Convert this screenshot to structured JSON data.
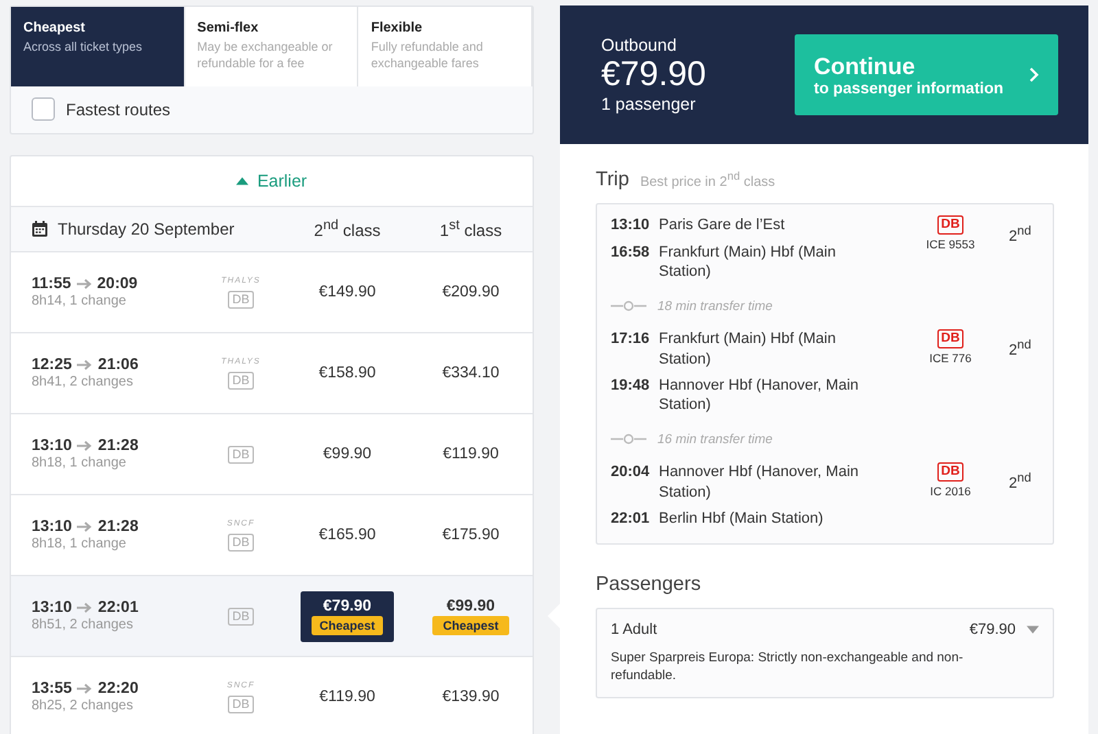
{
  "fare_tabs": [
    {
      "title": "Cheapest",
      "subtitle": "Across all ticket types",
      "selected": true
    },
    {
      "title": "Semi-flex",
      "subtitle": "May be exchangeable or refundable for a fee",
      "selected": false
    },
    {
      "title": "Flexible",
      "subtitle": "Fully refundable and exchangeable fares",
      "selected": false
    }
  ],
  "fastest_routes": {
    "label": "Fastest routes",
    "checked": false
  },
  "earlier_link": "Earlier",
  "results_header": {
    "date": "Thursday 20 September",
    "class_2": "2$^{nd}$ class",
    "class_1": "1$^{st}$ class"
  },
  "journeys": [
    {
      "depart": "11:55",
      "arrive": "20:09",
      "summary": "8h14, 1 change",
      "operators": [
        "THALYS",
        "DB"
      ],
      "selected": false,
      "prices": [
        {
          "price": "€149.90",
          "cheapest": false,
          "selected": false
        },
        {
          "price": "€209.90",
          "cheapest": false,
          "selected": false
        }
      ]
    },
    {
      "depart": "12:25",
      "arrive": "21:06",
      "summary": "8h41, 2 changes",
      "operators": [
        "THALYS",
        "DB"
      ],
      "selected": false,
      "prices": [
        {
          "price": "€158.90",
          "cheapest": false,
          "selected": false
        },
        {
          "price": "€334.10",
          "cheapest": false,
          "selected": false
        }
      ]
    },
    {
      "depart": "13:10",
      "arrive": "21:28",
      "summary": "8h18, 1 change",
      "operators": [
        "DB"
      ],
      "selected": false,
      "prices": [
        {
          "price": "€99.90",
          "cheapest": false,
          "selected": false
        },
        {
          "price": "€119.90",
          "cheapest": false,
          "selected": false
        }
      ]
    },
    {
      "depart": "13:10",
      "arrive": "21:28",
      "summary": "8h18, 1 change",
      "operators": [
        "SNCF",
        "DB"
      ],
      "selected": false,
      "prices": [
        {
          "price": "€165.90",
          "cheapest": false,
          "selected": false
        },
        {
          "price": "€175.90",
          "cheapest": false,
          "selected": false
        }
      ]
    },
    {
      "depart": "13:10",
      "arrive": "22:01",
      "summary": "8h51, 2 changes",
      "operators": [
        "DB"
      ],
      "selected": true,
      "prices": [
        {
          "price": "€79.90",
          "cheapest": true,
          "badge": "Cheapest",
          "selected": true
        },
        {
          "price": "€99.90",
          "cheapest": true,
          "badge": "Cheapest",
          "selected": false
        }
      ]
    },
    {
      "depart": "13:55",
      "arrive": "22:20",
      "summary": "8h25, 2 changes",
      "operators": [
        "SNCF",
        "DB"
      ],
      "selected": false,
      "prices": [
        {
          "price": "€119.90",
          "cheapest": false,
          "selected": false
        },
        {
          "price": "€139.90",
          "cheapest": false,
          "selected": false
        }
      ]
    }
  ],
  "summary": {
    "direction": "Outbound",
    "price": "€79.90",
    "passengers": "1 passenger",
    "continue_title": "Continue",
    "continue_subtitle": "to passenger information"
  },
  "trip": {
    "heading": "Trip",
    "note": "Best price in 2$^{nd}$ class",
    "segments": [
      {
        "kind": "leg",
        "dep_time": "13:10",
        "dep_station": "Paris Gare de l’Est",
        "arr_time": "16:58",
        "arr_station": "Frankfurt (Main) Hbf (Main Station)",
        "operator": "DB",
        "train": "ICE 9553",
        "class": "2$^{nd}$"
      },
      {
        "kind": "transfer",
        "text": "18 min transfer time"
      },
      {
        "kind": "leg",
        "dep_time": "17:16",
        "dep_station": "Frankfurt (Main) Hbf (Main Station)",
        "arr_time": "19:48",
        "arr_station": "Hannover Hbf (Hanover, Main Station)",
        "operator": "DB",
        "train": "ICE 776",
        "class": "2$^{nd}$"
      },
      {
        "kind": "transfer",
        "text": "16 min transfer time"
      },
      {
        "kind": "leg",
        "dep_time": "20:04",
        "dep_station": "Hannover Hbf (Hanover, Main Station)",
        "arr_time": "22:01",
        "arr_station": "Berlin Hbf (Main Station)",
        "operator": "DB",
        "train": "IC 2016",
        "class": "2$^{nd}$"
      }
    ]
  },
  "passengers": {
    "heading": "Passengers",
    "items": [
      {
        "label": "1 Adult",
        "price": "€79.90",
        "fare_note": "Super Sparpreis Europa: Strictly non-exchangeable and non-refundable."
      }
    ]
  }
}
